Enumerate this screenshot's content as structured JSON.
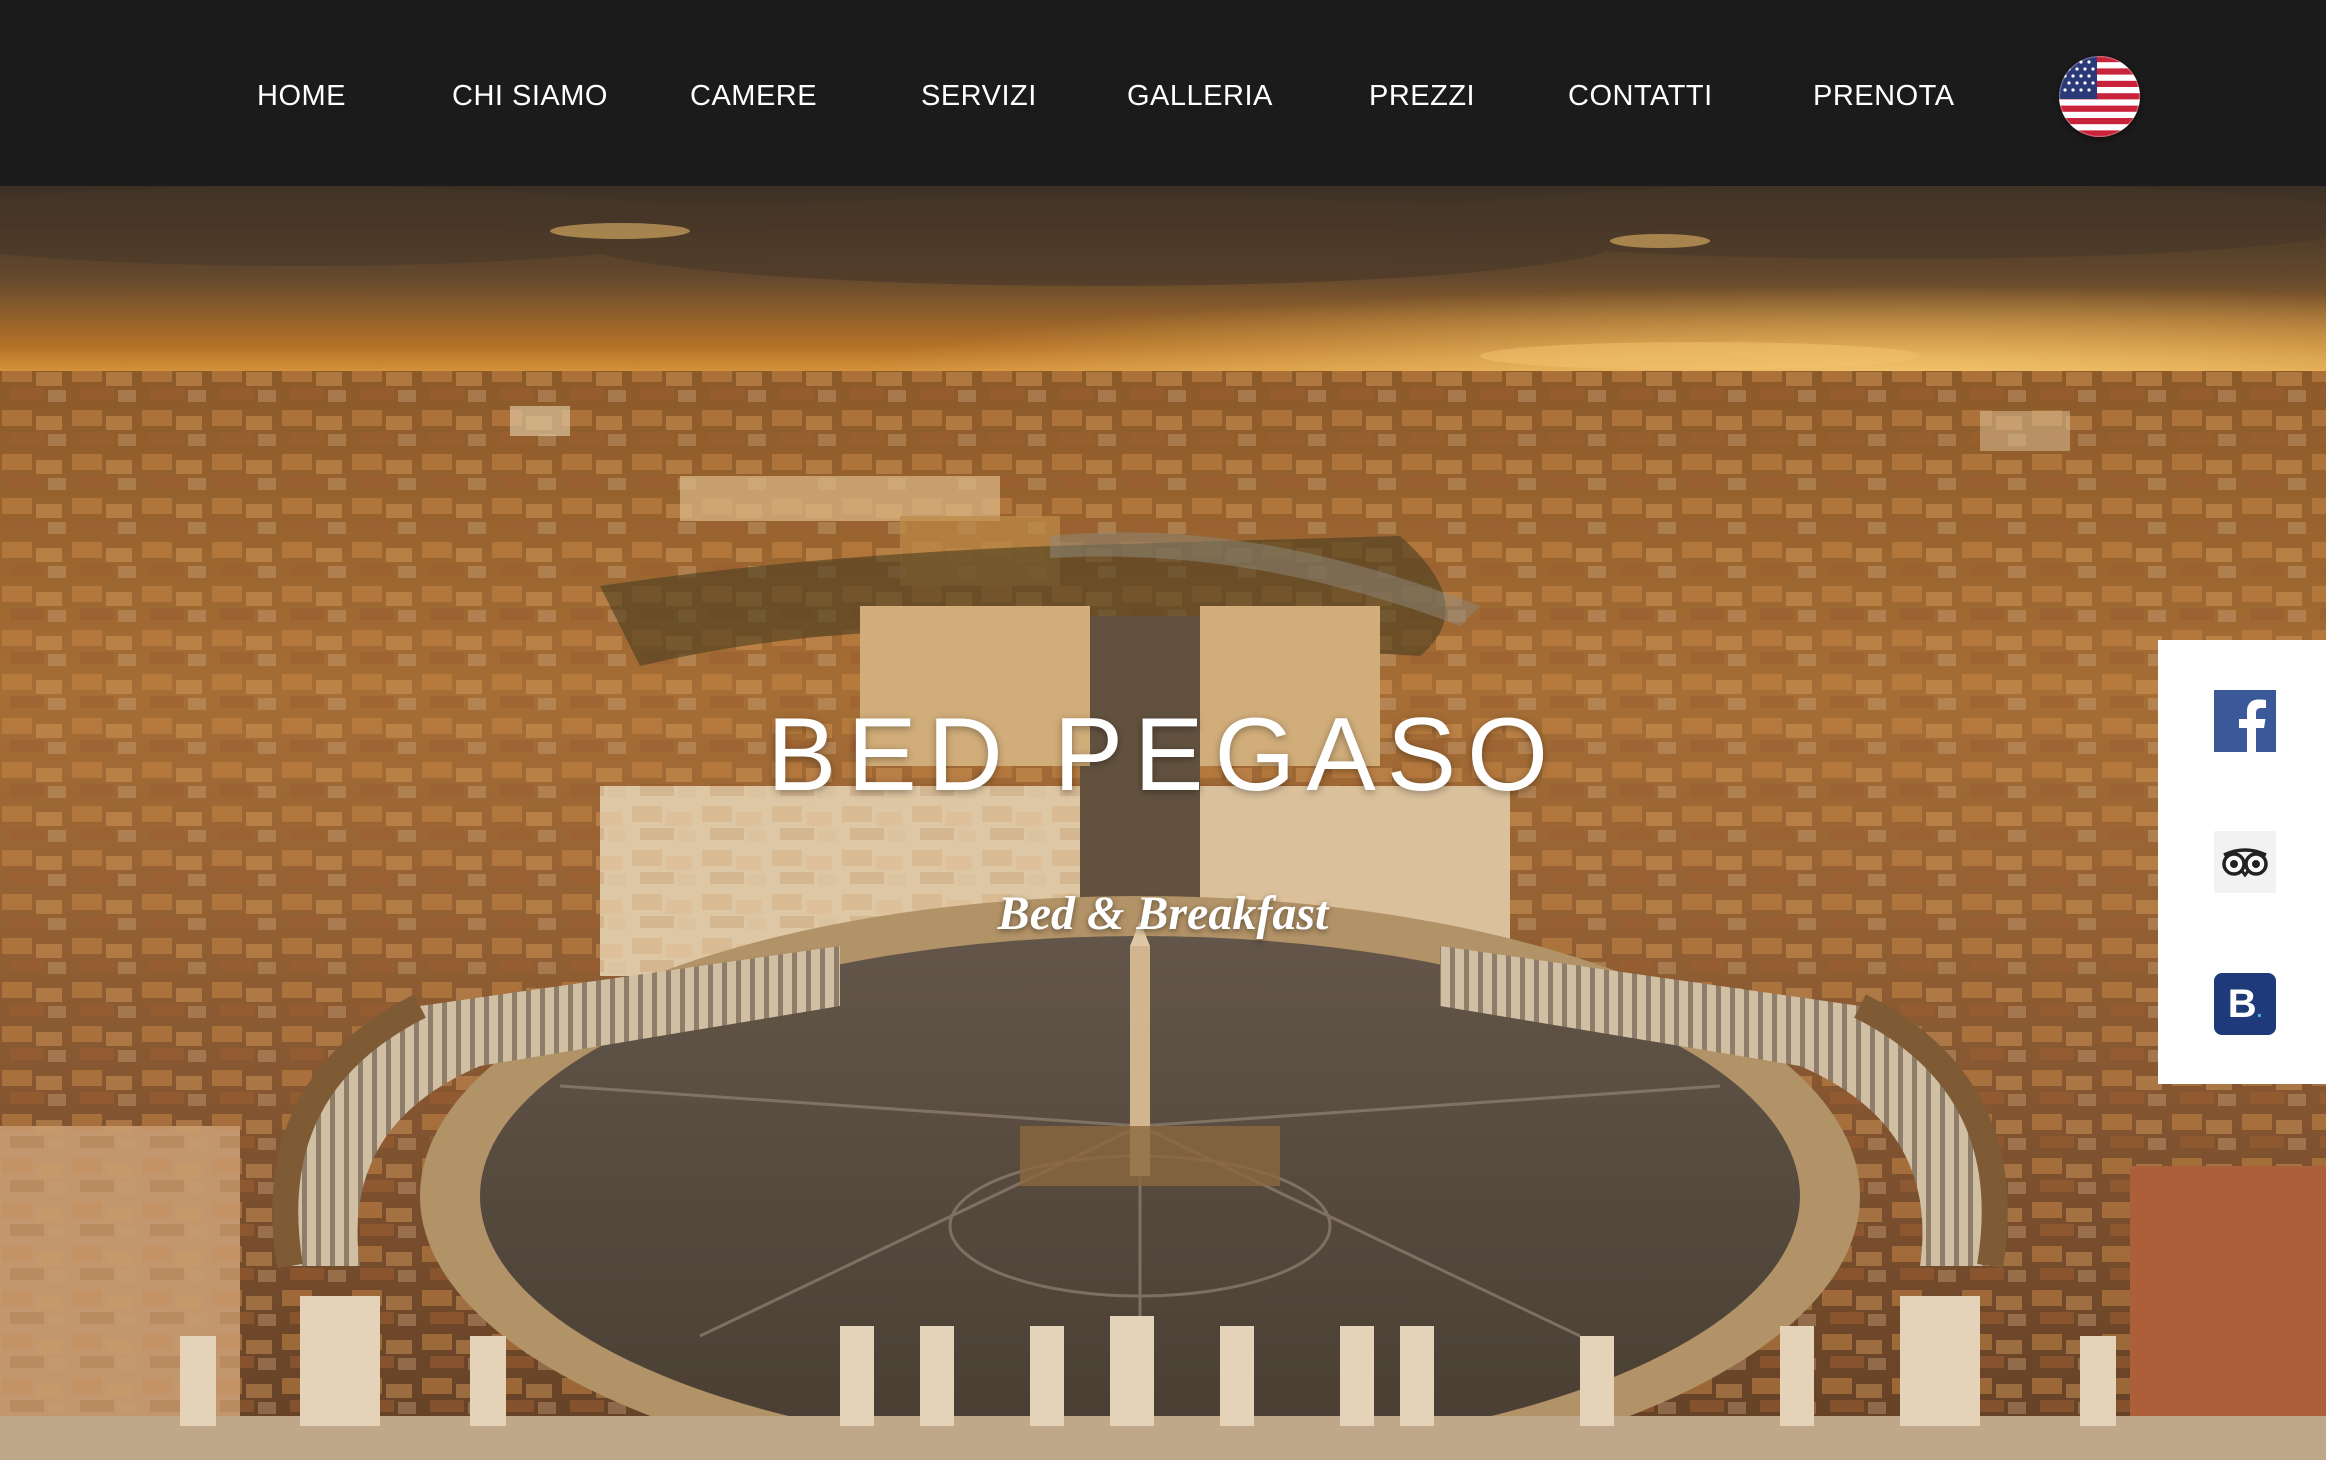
{
  "nav": {
    "items": [
      {
        "label": "HOME"
      },
      {
        "label": "CHI SIAMO"
      },
      {
        "label": "CAMERE"
      },
      {
        "label": "SERVIZI"
      },
      {
        "label": "GALLERIA"
      },
      {
        "label": "PREZZI"
      },
      {
        "label": "CONTATTI"
      },
      {
        "label": "PRENOTA"
      }
    ],
    "language_icon": "us-flag-icon"
  },
  "hero": {
    "title": "BED PEGASO",
    "subtitle": "Bed & Breakfast"
  },
  "social": {
    "facebook_icon": "facebook-icon",
    "tripadvisor_icon": "tripadvisor-icon",
    "booking_icon": "booking-icon",
    "booking_letter": "B",
    "facebook_color": "#3b5998",
    "booking_color": "#1f3a7a"
  }
}
